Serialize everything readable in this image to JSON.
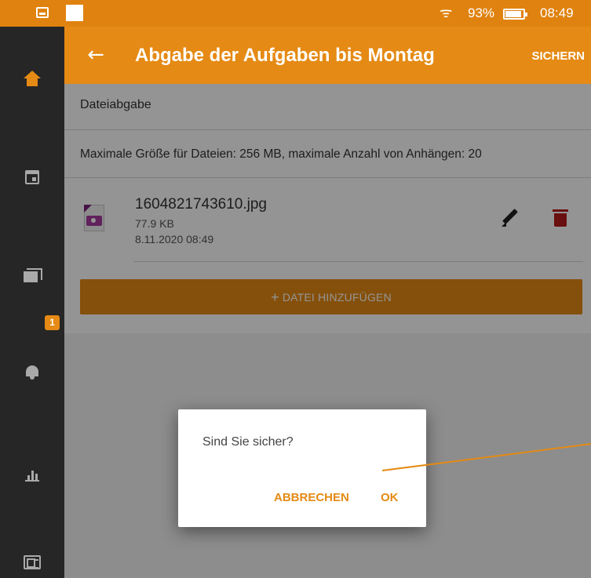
{
  "status_bar": {
    "battery_percent": "93%",
    "time": "08:49",
    "icons": [
      "image-icon",
      "blank-square-icon",
      "wifi-icon",
      "battery-icon"
    ]
  },
  "sidebar": {
    "items": [
      {
        "icon": "home-icon",
        "active": true
      },
      {
        "icon": "calendar-icon",
        "active": false
      },
      {
        "icon": "chat-icon",
        "active": false
      },
      {
        "icon": "bell-icon",
        "active": false,
        "badge": "1"
      },
      {
        "icon": "stats-icon",
        "active": false
      },
      {
        "icon": "news-icon",
        "active": false
      }
    ]
  },
  "appbar": {
    "back_icon": "arrow-back-icon",
    "title": "Abgabe der Aufgaben bis Montag",
    "action_label": "SICHERN"
  },
  "content": {
    "section_title": "Dateiabgabe",
    "limits_text": "Maximale Größe für Dateien: 256 MB, maximale Anzahl von Anhängen: 20",
    "files": [
      {
        "icon": "image-file-icon",
        "name": "1604821743610.jpg",
        "size": "77.9 KB",
        "date": "8.11.2020 08:49"
      }
    ],
    "add_button_label": "DATEI HINZUFÜGEN"
  },
  "dialog": {
    "message": "Sind Sie sicher?",
    "cancel_label": "ABBRECHEN",
    "ok_label": "OK"
  },
  "colors": {
    "accent": "#e58a14",
    "status_bar": "#e0820f",
    "sidebar_bg": "#262626",
    "delete_red": "#b51a1a"
  }
}
